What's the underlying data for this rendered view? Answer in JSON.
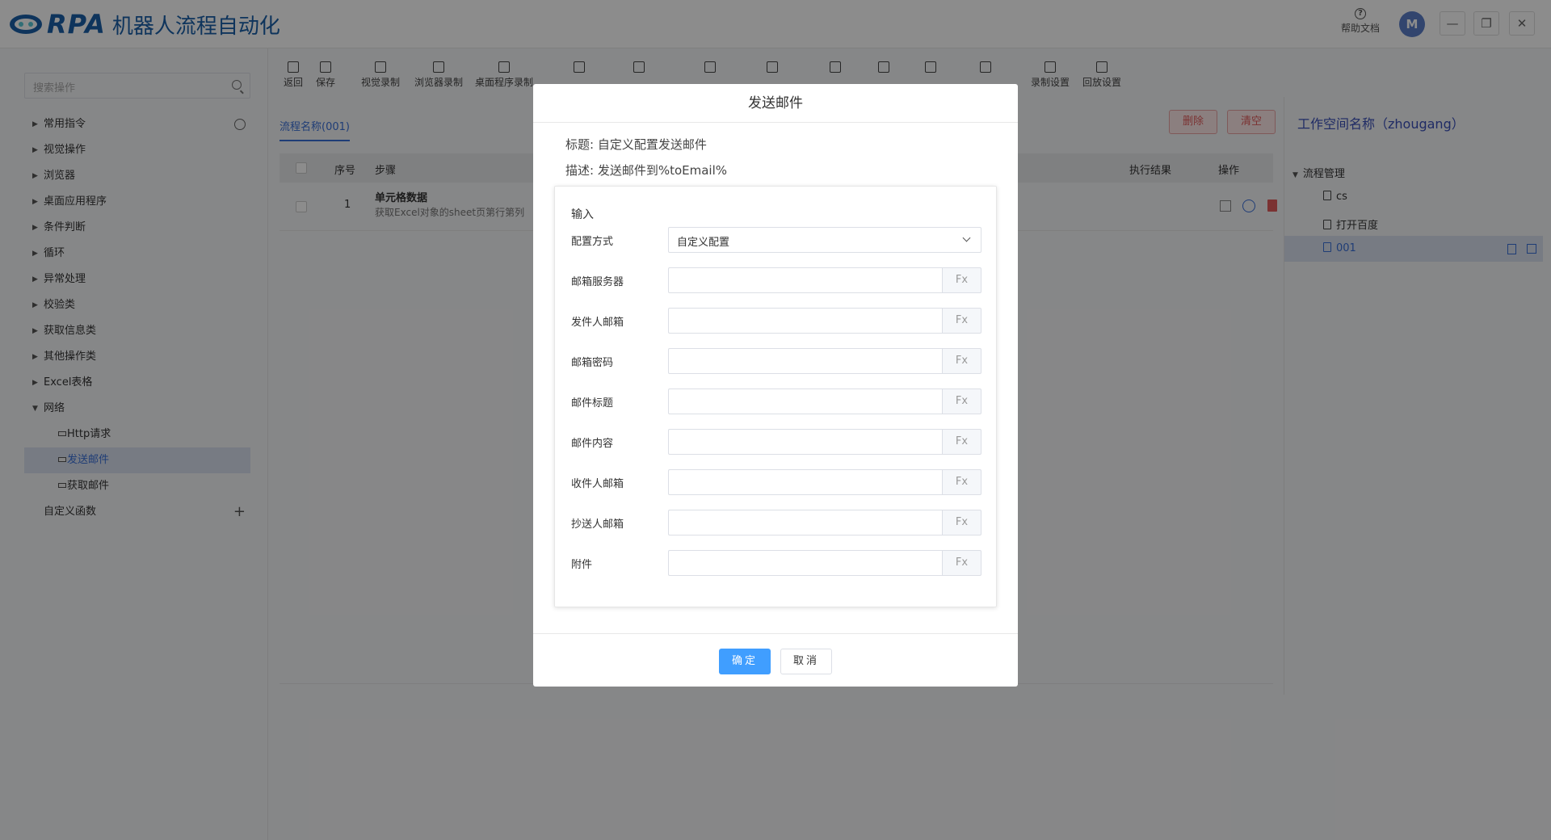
{
  "app": {
    "logo_text": "RPA",
    "title": "机器人流程自动化",
    "help_label": "帮助文档",
    "avatar_letter": "M",
    "window_buttons": {
      "minimize": "—",
      "restore": "❐",
      "close": "✕"
    }
  },
  "sidebar": {
    "search_placeholder": "搜索操作",
    "items": [
      {
        "label": "常用指令",
        "expanded": false
      },
      {
        "label": "视觉操作",
        "expanded": false
      },
      {
        "label": "浏览器",
        "expanded": false
      },
      {
        "label": "桌面应用程序",
        "expanded": false
      },
      {
        "label": "条件判断",
        "expanded": false
      },
      {
        "label": "循环",
        "expanded": false
      },
      {
        "label": "异常处理",
        "expanded": false
      },
      {
        "label": "校验类",
        "expanded": false
      },
      {
        "label": "获取信息类",
        "expanded": false
      },
      {
        "label": "其他操作类",
        "expanded": false
      },
      {
        "label": "Excel表格",
        "expanded": false
      },
      {
        "label": "网络",
        "expanded": true
      }
    ],
    "network_children": [
      {
        "label": "Http请求",
        "active": false
      },
      {
        "label": "发送邮件",
        "active": true
      },
      {
        "label": "获取邮件",
        "active": false
      }
    ],
    "custom_functions": "自定义函数"
  },
  "toolbar": {
    "items": [
      {
        "label": "返回",
        "icon": "undo-icon"
      },
      {
        "label": "保存",
        "icon": "save-icon"
      },
      {
        "label": "视觉录制",
        "icon": "vision-record-icon"
      },
      {
        "label": "浏览器录制",
        "icon": "browser-record-icon"
      },
      {
        "label": "桌面程序录制",
        "icon": "desktop-record-icon"
      },
      {
        "label": "",
        "icon": "toolbar-icon-6"
      },
      {
        "label": "",
        "icon": "toolbar-icon-7"
      },
      {
        "label": "",
        "icon": "toolbar-icon-8"
      },
      {
        "label": "",
        "icon": "toolbar-icon-9"
      },
      {
        "label": "",
        "icon": "toolbar-icon-10"
      },
      {
        "label": "",
        "icon": "toolbar-icon-11"
      },
      {
        "label": "",
        "icon": "toolbar-icon-12"
      },
      {
        "label": "",
        "icon": "toolbar-icon-13"
      },
      {
        "label": "录制设置",
        "icon": "record-settings-icon"
      },
      {
        "label": "回放设置",
        "icon": "playback-settings-icon"
      }
    ]
  },
  "editor": {
    "tab_label": "流程名称(001)",
    "delete_label": "删除",
    "clear_label": "清空",
    "columns": {
      "index": "序号",
      "step": "步骤",
      "result": "执行结果",
      "actions": "操作"
    },
    "rows": [
      {
        "index": "1",
        "title": "单元格数据",
        "desc": "获取Excel对象的sheet页第行第列"
      }
    ]
  },
  "workspace": {
    "title": "工作空间名称（zhougang）",
    "root": "流程管理",
    "children": [
      "cs",
      "打开百度",
      "001"
    ]
  },
  "modal": {
    "title": "发送邮件",
    "meta_title_label": "标题:",
    "meta_title_value": "自定义配置发送邮件",
    "meta_desc_label": "描述:",
    "meta_desc_value": "发送邮件到%toEmail%",
    "section_label": "输入",
    "config_label": "配置方式",
    "config_value": "自定义配置",
    "fx_label": "Fx",
    "fields": [
      "邮箱服务器",
      "发件人邮箱",
      "邮箱密码",
      "邮件标题",
      "邮件内容",
      "收件人邮箱",
      "抄送人邮箱",
      "附件"
    ],
    "ok_label": "确定",
    "cancel_label": "取消"
  }
}
